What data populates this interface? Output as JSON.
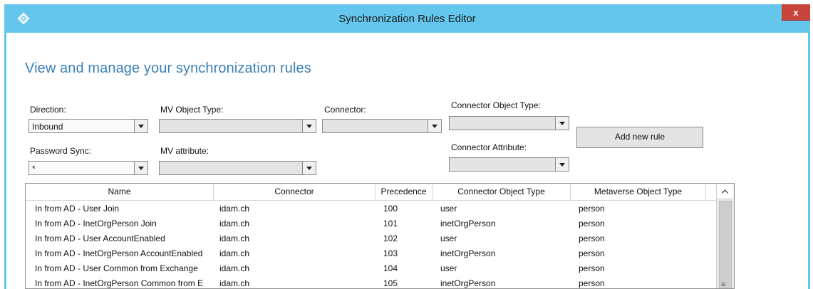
{
  "window": {
    "title": "Synchronization Rules Editor",
    "close_label": "x",
    "colors": {
      "titlebar": "#64c6ec",
      "heading": "#3a7fb7",
      "close": "#c8433a"
    }
  },
  "heading": "View and manage your synchronization rules",
  "filters": {
    "direction": {
      "label": "Direction:",
      "value": "Inbound"
    },
    "mv_object_type": {
      "label": "MV Object Type:",
      "value": ""
    },
    "connector": {
      "label": "Connector:",
      "value": ""
    },
    "connector_object_type": {
      "label": "Connector Object Type:",
      "value": ""
    },
    "password_sync": {
      "label": "Password Sync:",
      "value": "*"
    },
    "mv_attribute": {
      "label": "MV attribute:",
      "value": ""
    },
    "connector_attribute": {
      "label": "Connector Attribute:",
      "value": ""
    }
  },
  "add_rule_button": "Add new rule",
  "grid": {
    "columns": [
      "Name",
      "Connector",
      "Precedence",
      "Connector Object Type",
      "Metaverse Object Type"
    ],
    "rows": [
      [
        "In from AD - User Join",
        "idam.ch",
        "100",
        "user",
        "person"
      ],
      [
        "In from AD - InetOrgPerson Join",
        "idam.ch",
        "101",
        "inetOrgPerson",
        "person"
      ],
      [
        "In from AD - User AccountEnabled",
        "idam.ch",
        "102",
        "user",
        "person"
      ],
      [
        "In from AD - InetOrgPerson AccountEnabled",
        "idam.ch",
        "103",
        "inetOrgPerson",
        "person"
      ],
      [
        "In from AD - User Common from Exchange",
        "idam.ch",
        "104",
        "user",
        "person"
      ],
      [
        "In from AD - InetOrgPerson Common from E",
        "idam.ch",
        "105",
        "inetOrgPerson",
        "person"
      ]
    ]
  },
  "icons": {
    "app": "diamond-sync-icon",
    "dropdown": "chevron-down-icon",
    "scroll_up": "chevron-up-icon",
    "scroll_grip": "grip-icon"
  }
}
